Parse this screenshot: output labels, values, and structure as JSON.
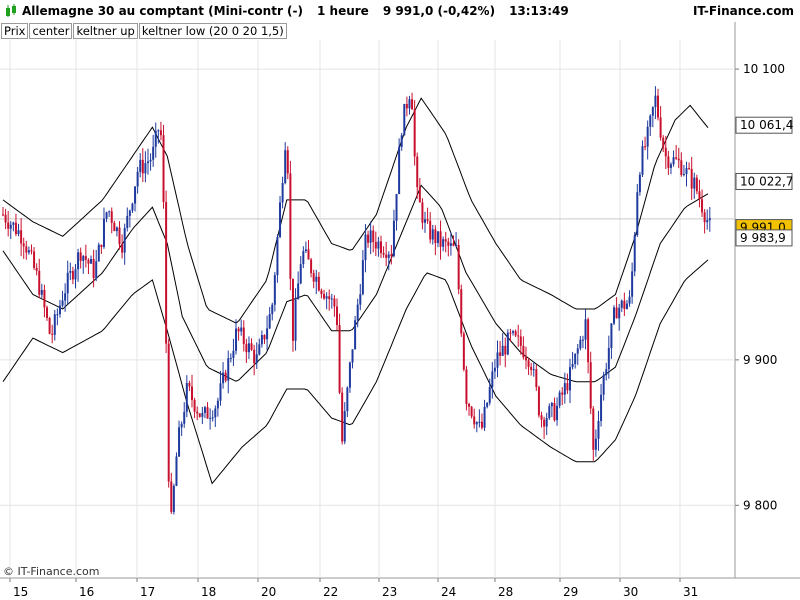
{
  "header": {
    "instrument": "Allemagne 30 au comptant (Mini-contr (-)",
    "interval": "1 heure",
    "quote": "9 991,0 (-0,42%)",
    "time": "13:13:49",
    "brand": "IT-Finance.com"
  },
  "legend": {
    "items": [
      "Prix",
      "center",
      "keltner up",
      "keltner low (20 0 20 1,5)"
    ]
  },
  "watermark": "© IT-Finance.com",
  "colors": {
    "up": "#1f3a9e",
    "down": "#c8102e",
    "band": "#000000",
    "grid": "#e4e4e4",
    "price_label": "#f2c200"
  },
  "chart_data": {
    "type": "candlestick",
    "title": "Allemagne 30 au comptant (Mini-contr (-)",
    "interval": "1 heure",
    "ylim": [
      9750,
      10120
    ],
    "x_tick_labels": [
      "15",
      "16",
      "17",
      "18",
      "20",
      "22",
      "23",
      "24",
      "28",
      "29",
      "30",
      "31"
    ],
    "y_tick_labels": [
      "10 100",
      "9 900",
      "9 800"
    ],
    "y_ticks": [
      10100,
      9900,
      9800
    ],
    "price_labels": [
      {
        "text": "10 061,4",
        "value": 10061.4,
        "style": "band"
      },
      {
        "text": "10 022,7",
        "value": 10022.7,
        "style": "band"
      },
      {
        "text": "9 991,0",
        "value": 9991.0,
        "style": "last"
      },
      {
        "text": "9 983,9",
        "value": 9983.9,
        "style": "band"
      }
    ],
    "close_series": [
      [
        0,
        10000
      ],
      [
        20,
        9985
      ],
      [
        35,
        9955
      ],
      [
        48,
        9915
      ],
      [
        60,
        9945
      ],
      [
        78,
        9975
      ],
      [
        92,
        9960
      ],
      [
        105,
        10005
      ],
      [
        120,
        9980
      ],
      [
        135,
        10030
      ],
      [
        150,
        10040
      ],
      [
        158,
        10065
      ],
      [
        162,
        9990
      ],
      [
        165,
        9860
      ],
      [
        168,
        9780
      ],
      [
        175,
        9840
      ],
      [
        185,
        9880
      ],
      [
        200,
        9860
      ],
      [
        215,
        9870
      ],
      [
        235,
        9920
      ],
      [
        255,
        9900
      ],
      [
        270,
        9935
      ],
      [
        285,
        10065
      ],
      [
        290,
        9910
      ],
      [
        300,
        9975
      ],
      [
        320,
        9950
      ],
      [
        335,
        9935
      ],
      [
        340,
        9840
      ],
      [
        350,
        9905
      ],
      [
        365,
        9985
      ],
      [
        390,
        9975
      ],
      [
        400,
        10060
      ],
      [
        410,
        10090
      ],
      [
        415,
        10015
      ],
      [
        425,
        9990
      ],
      [
        440,
        9980
      ],
      [
        455,
        9975
      ],
      [
        465,
        9875
      ],
      [
        480,
        9850
      ],
      [
        495,
        9900
      ],
      [
        510,
        9915
      ],
      [
        520,
        9910
      ],
      [
        530,
        9900
      ],
      [
        540,
        9860
      ],
      [
        555,
        9865
      ],
      [
        570,
        9890
      ],
      [
        585,
        9925
      ],
      [
        593,
        9835
      ],
      [
        600,
        9875
      ],
      [
        615,
        9935
      ],
      [
        630,
        9940
      ],
      [
        638,
        10030
      ],
      [
        648,
        10055
      ],
      [
        655,
        10080
      ],
      [
        665,
        10040
      ],
      [
        680,
        10035
      ],
      [
        695,
        10020
      ],
      [
        710,
        9991
      ]
    ],
    "center_series": [
      [
        0,
        9975
      ],
      [
        30,
        9945
      ],
      [
        60,
        9935
      ],
      [
        100,
        9960
      ],
      [
        130,
        9990
      ],
      [
        150,
        10005
      ],
      [
        165,
        9980
      ],
      [
        180,
        9930
      ],
      [
        205,
        9895
      ],
      [
        235,
        9885
      ],
      [
        265,
        9905
      ],
      [
        285,
        9940
      ],
      [
        305,
        9945
      ],
      [
        330,
        9920
      ],
      [
        350,
        9920
      ],
      [
        375,
        9945
      ],
      [
        405,
        9995
      ],
      [
        420,
        10020
      ],
      [
        440,
        10005
      ],
      [
        465,
        9960
      ],
      [
        495,
        9925
      ],
      [
        520,
        9905
      ],
      [
        550,
        9890
      ],
      [
        575,
        9885
      ],
      [
        595,
        9885
      ],
      [
        615,
        9895
      ],
      [
        635,
        9930
      ],
      [
        660,
        9980
      ],
      [
        685,
        10005
      ],
      [
        710,
        10015
      ]
    ],
    "upper_series": [
      [
        0,
        10010
      ],
      [
        30,
        9995
      ],
      [
        60,
        9985
      ],
      [
        100,
        10010
      ],
      [
        130,
        10040
      ],
      [
        150,
        10060
      ],
      [
        165,
        10040
      ],
      [
        185,
        9980
      ],
      [
        205,
        9935
      ],
      [
        235,
        9925
      ],
      [
        265,
        9955
      ],
      [
        285,
        10010
      ],
      [
        305,
        10010
      ],
      [
        330,
        9980
      ],
      [
        350,
        9975
      ],
      [
        375,
        10000
      ],
      [
        405,
        10060
      ],
      [
        420,
        10080
      ],
      [
        445,
        10055
      ],
      [
        470,
        10010
      ],
      [
        495,
        9980
      ],
      [
        520,
        9955
      ],
      [
        550,
        9945
      ],
      [
        575,
        9935
      ],
      [
        595,
        9935
      ],
      [
        615,
        9945
      ],
      [
        635,
        9985
      ],
      [
        655,
        10035
      ],
      [
        675,
        10065
      ],
      [
        690,
        10075
      ],
      [
        710,
        10058
      ]
    ],
    "lower_series": [
      [
        0,
        9885
      ],
      [
        30,
        9915
      ],
      [
        60,
        9905
      ],
      [
        100,
        9920
      ],
      [
        130,
        9945
      ],
      [
        150,
        9955
      ],
      [
        165,
        9920
      ],
      [
        185,
        9870
      ],
      [
        210,
        9815
      ],
      [
        240,
        9840
      ],
      [
        265,
        9855
      ],
      [
        285,
        9880
      ],
      [
        305,
        9880
      ],
      [
        330,
        9860
      ],
      [
        350,
        9855
      ],
      [
        375,
        9885
      ],
      [
        405,
        9935
      ],
      [
        425,
        9960
      ],
      [
        445,
        9955
      ],
      [
        470,
        9910
      ],
      [
        495,
        9875
      ],
      [
        520,
        9855
      ],
      [
        550,
        9840
      ],
      [
        575,
        9830
      ],
      [
        595,
        9830
      ],
      [
        615,
        9845
      ],
      [
        635,
        9875
      ],
      [
        660,
        9925
      ],
      [
        685,
        9955
      ],
      [
        710,
        9970
      ]
    ]
  }
}
